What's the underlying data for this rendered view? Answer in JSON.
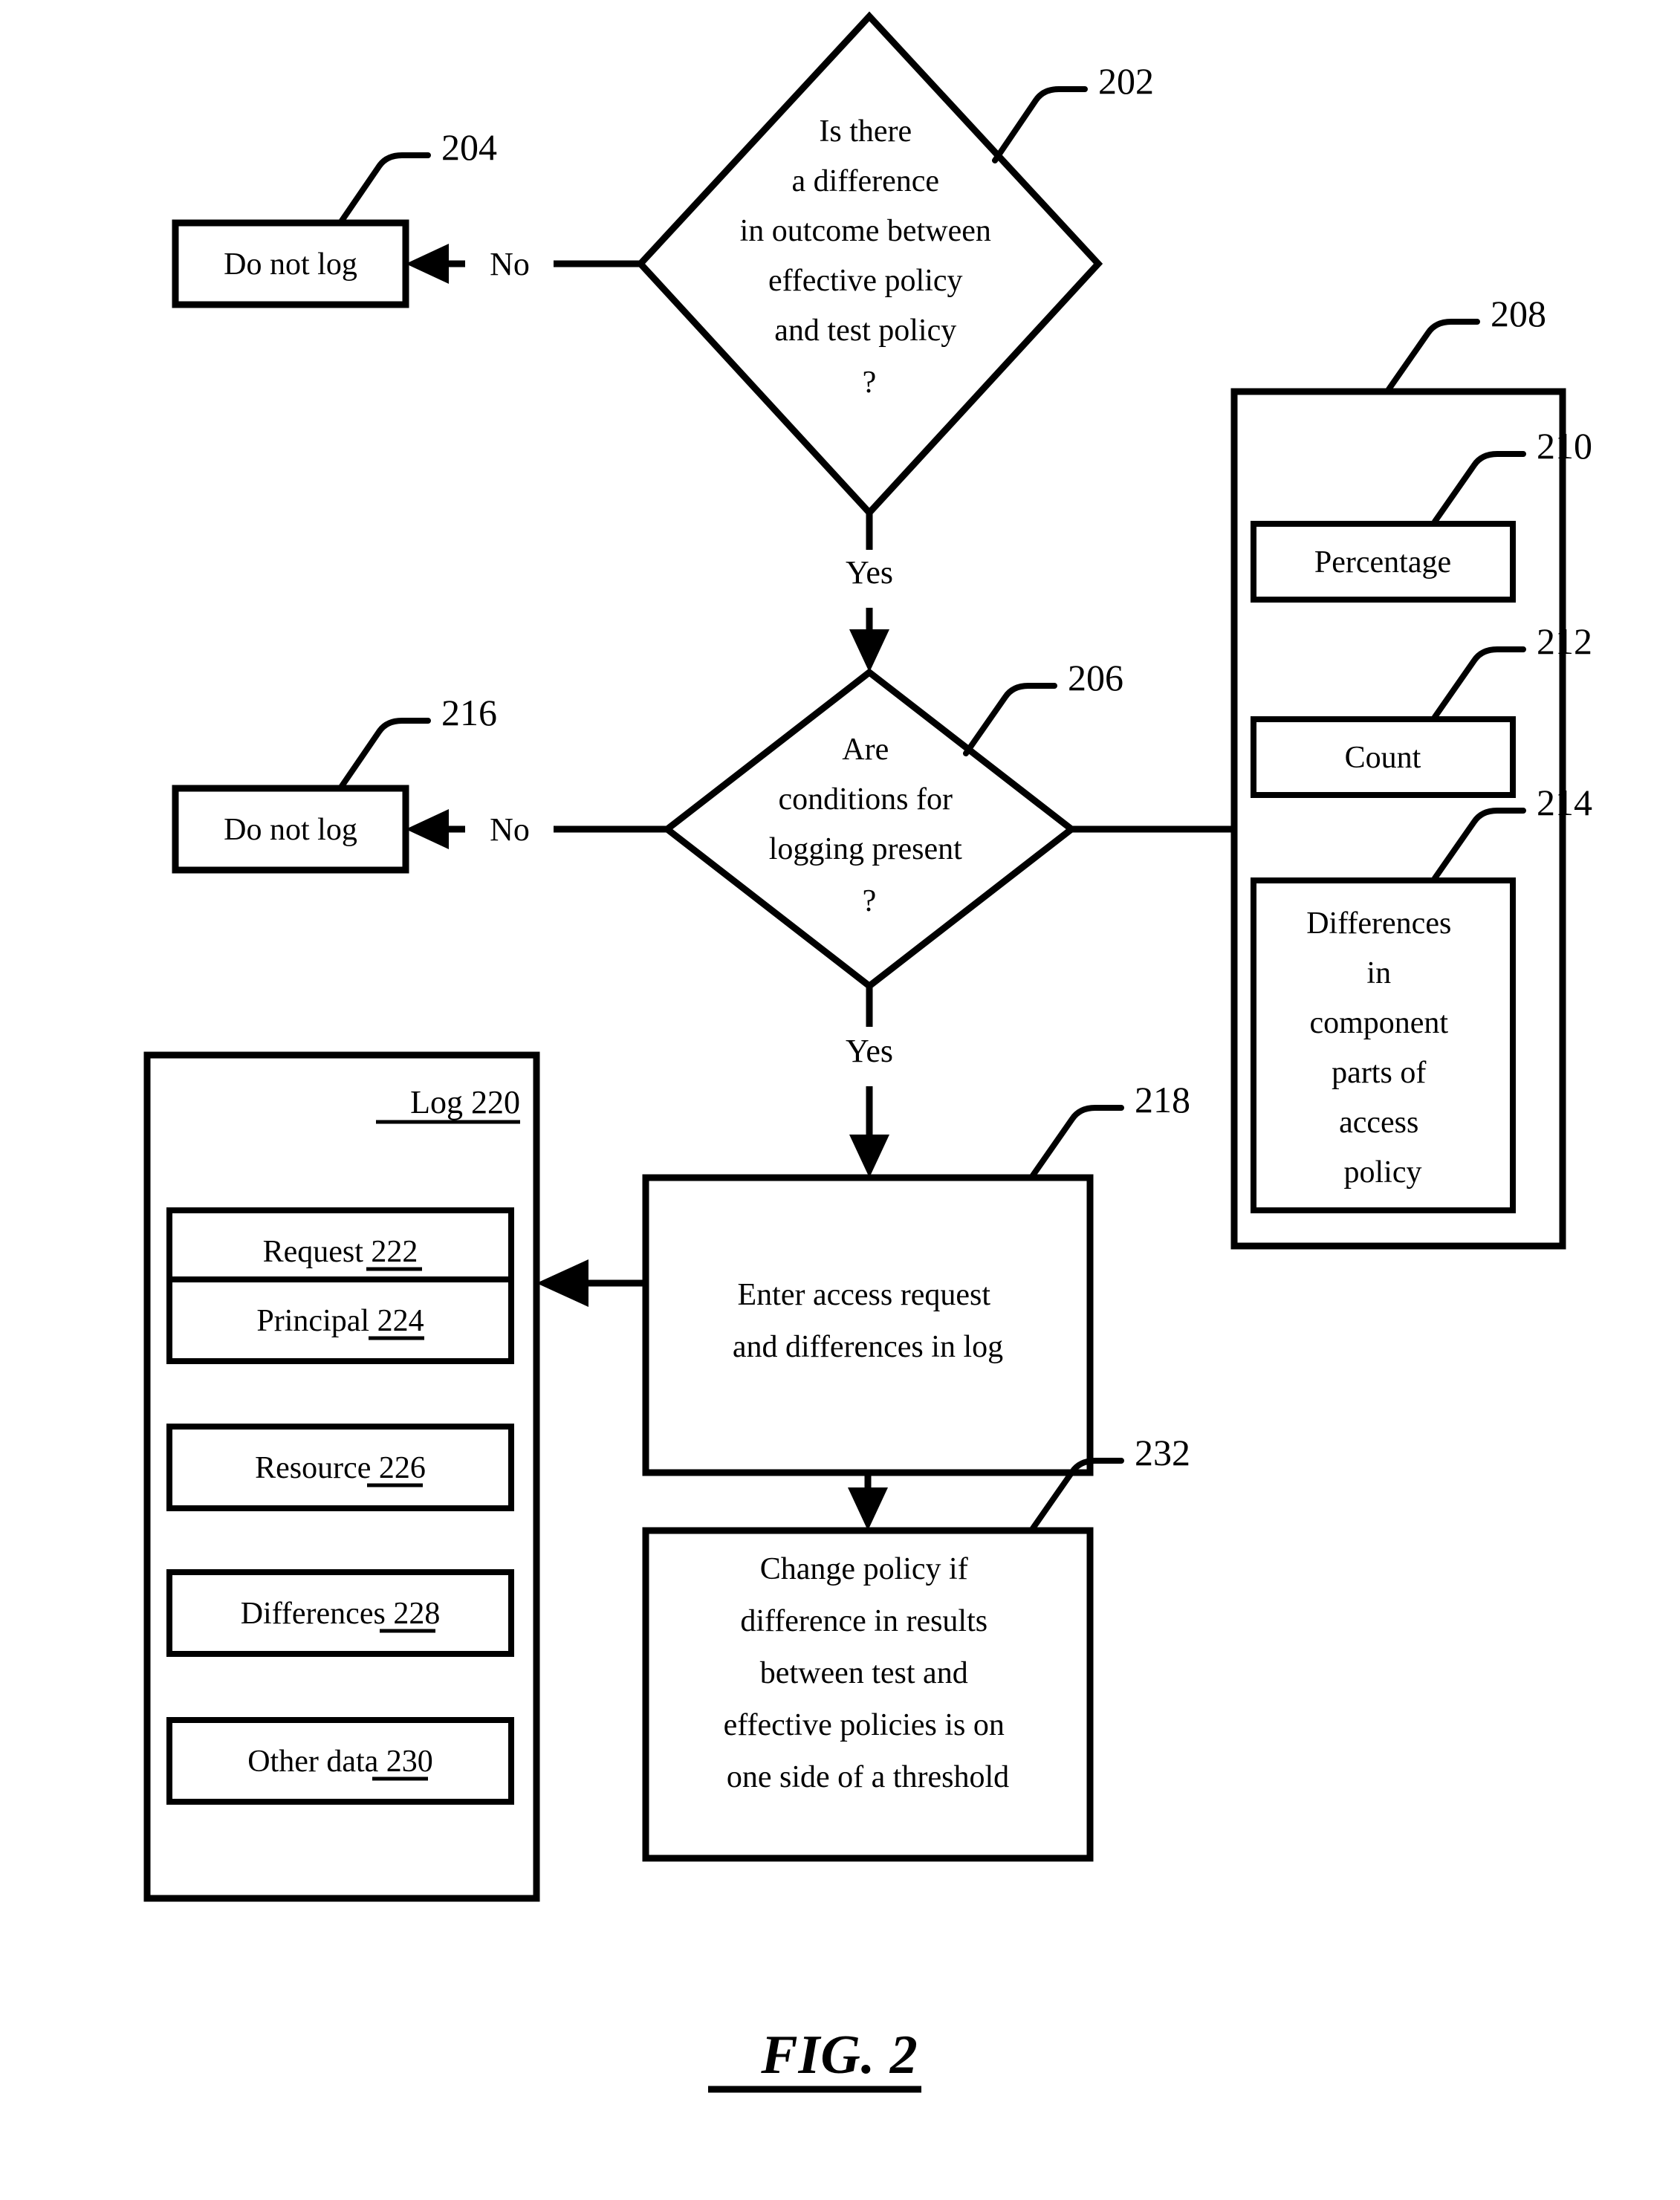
{
  "figure": {
    "caption": "FIG. 2"
  },
  "nodes": {
    "decision_202": {
      "ref": "202",
      "lines": [
        "Is there",
        "a difference",
        "in outcome between",
        "effective policy",
        "and test policy",
        "?"
      ]
    },
    "box_204": {
      "ref": "204",
      "label": "Do not log"
    },
    "decision_206": {
      "ref": "206",
      "lines": [
        "Are",
        "conditions for",
        "logging present",
        "?"
      ]
    },
    "box_216": {
      "ref": "216",
      "label": "Do not log"
    },
    "container_208": {
      "ref": "208",
      "children": [
        {
          "ref": "210",
          "lines": [
            "Percentage"
          ]
        },
        {
          "ref": "212",
          "lines": [
            "Count"
          ]
        },
        {
          "ref": "214",
          "lines": [
            "Differences",
            "in",
            "component",
            "parts of",
            "access",
            "policy"
          ]
        }
      ]
    },
    "box_218": {
      "ref": "218",
      "lines": [
        "Enter access request",
        "and differences in log"
      ]
    },
    "box_232": {
      "ref": "232",
      "lines": [
        "Change policy if",
        "difference in results",
        "between test and",
        "effective policies is on",
        "one side of a threshold"
      ]
    },
    "container_220": {
      "title_text": "Log",
      "title_ref": "220",
      "items": [
        {
          "text": "Request",
          "ref": "222"
        },
        {
          "text": "Principal",
          "ref": "224"
        },
        {
          "text": "Resource",
          "ref": "226"
        },
        {
          "text": "Differences",
          "ref": "228"
        },
        {
          "text": "Other data",
          "ref": "230"
        }
      ]
    }
  },
  "edges": {
    "no_202_to_204": "No",
    "yes_202_to_206": "Yes",
    "no_206_to_216": "No",
    "yes_206_to_218": "Yes"
  },
  "colors": {
    "stroke": "#000000",
    "fill": "#ffffff"
  }
}
